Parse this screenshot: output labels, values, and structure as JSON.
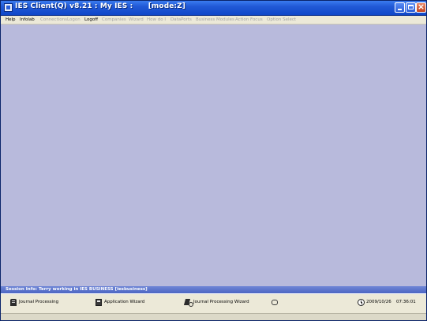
{
  "window": {
    "title": "IES Client(Q) v8.21 : My IES :      [mode:Z]"
  },
  "menu": {
    "items": [
      {
        "label": "Help",
        "enabled": true
      },
      {
        "label": "Infolab",
        "enabled": true
      },
      {
        "label": "Connections",
        "enabled": false
      },
      {
        "label": "Logon",
        "enabled": false
      },
      {
        "label": "Logoff",
        "enabled": true
      },
      {
        "label": "Companies",
        "enabled": false
      },
      {
        "label": "Wizard",
        "enabled": false
      },
      {
        "label": "How do I",
        "enabled": false
      },
      {
        "label": "DataPorts",
        "enabled": false
      },
      {
        "label": "Business Modules",
        "enabled": false
      },
      {
        "label": "Action Focus",
        "enabled": false
      },
      {
        "label": "Option Select",
        "enabled": false
      }
    ]
  },
  "session": {
    "info": "Session Info: Terry working in IES BUSINESS  [iesbusiness]"
  },
  "taskbar": {
    "items": [
      {
        "label": "Journal Processing",
        "icon": "journal-icon"
      },
      {
        "label": "Application Wizard",
        "icon": "application-wizard-icon"
      },
      {
        "label": "Journal Processing Wizard",
        "icon": "journal-wizard-icon"
      },
      {
        "label": "",
        "icon": "misc-icon"
      }
    ],
    "date": "2009/10/26",
    "time": "07:36:01",
    "clock_icon": "clock-icon"
  },
  "colors": {
    "titlebar": "#2159d6",
    "menubar": "#ece9d8",
    "workspace": "#b8badc",
    "session_bar": "#5a72cc"
  }
}
